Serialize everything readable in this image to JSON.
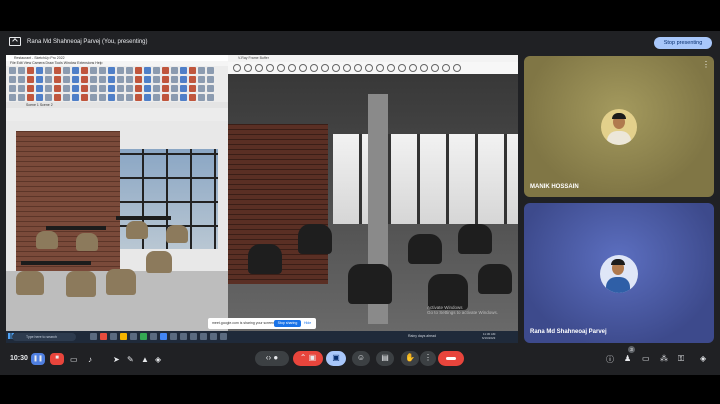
{
  "meet": {
    "presenter_label": "Rana Md Shahneoaj Parvej (You, presenting)",
    "stop_presenting": "Stop presenting",
    "clock": "10:30"
  },
  "shared_screen": {
    "sketchup_title": "Restaurant - SketchUp Pro 2022",
    "sketchup_menu": "File  Edit  View  Camera  Draw  Tools  Window  Extensions  Help",
    "sketchup_tabs": "Scene 1   Scene 2",
    "vray_title": "V-Ray Frame Buffer",
    "activate_windows_title": "Activate Windows",
    "activate_windows_sub": "Go to Settings to activate Windows.",
    "share_notice": "meet.google.com is sharing your screen.",
    "share_notice_button": "Stop sharing",
    "share_notice_hide": "Hide",
    "taskbar_search": "Type here to search",
    "weather": "Rainy days ahead",
    "taskbar_time": "11:30 AM",
    "taskbar_date": "6/19/2023"
  },
  "participants": [
    {
      "name": "MANIK HOSSAIN"
    },
    {
      "name": "Rana Md Shahneoaj Parvej"
    }
  ],
  "controls": {
    "participants_badge": "3"
  },
  "colors": {
    "meet_bg": "#202124",
    "accent_blue": "#a8c7fa",
    "end_call_red": "#e8453c"
  }
}
